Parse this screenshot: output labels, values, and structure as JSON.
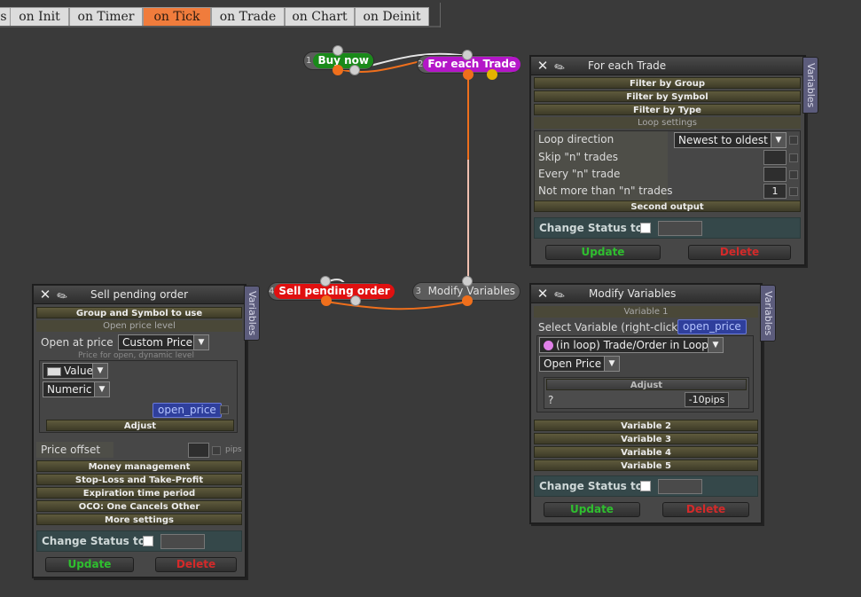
{
  "tabs": [
    {
      "label": "s",
      "active": false
    },
    {
      "label": "on Init",
      "active": false
    },
    {
      "label": "on Timer",
      "active": false
    },
    {
      "label": "on Tick",
      "active": true
    },
    {
      "label": "on Trade",
      "active": false
    },
    {
      "label": "on Chart",
      "active": false
    },
    {
      "label": "on Deinit",
      "active": false
    }
  ],
  "nodes": {
    "buy_now": {
      "num": "1",
      "label": "Buy now",
      "color": "#1a8a1a"
    },
    "for_each_trade": {
      "num": "2",
      "label": "For each Trade",
      "color": "#b416c8"
    },
    "modify_variables": {
      "num": "3",
      "label": "Modify Variables",
      "color": "#5c5c5c"
    },
    "sell_pending_order": {
      "num": "4",
      "label": "Sell pending order",
      "color": "#e01010"
    }
  },
  "wire_colors": {
    "main": "#ef6f1c",
    "light": "#e6e6e6",
    "vertical": "#f08050"
  },
  "panel_for_each": {
    "title": "For each Trade",
    "variables_tab": "Variables",
    "sections": [
      "Filter by Group",
      "Filter by Symbol",
      "Filter by Type"
    ],
    "loop_settings": "Loop settings",
    "rows": {
      "loop_direction": {
        "label": "Loop direction",
        "value": "Newest to oldest"
      },
      "skip_n": {
        "label": "Skip \"n\" trades",
        "value": ""
      },
      "every_n": {
        "label": "Every \"n\" trade",
        "value": ""
      },
      "not_more_than": {
        "label": "Not more than \"n\" trades",
        "value": "1"
      }
    },
    "second_output": "Second output",
    "change_status": "Change Status to",
    "update": "Update",
    "delete": "Delete"
  },
  "panel_sell": {
    "title": "Sell pending order",
    "variables_tab": "Variables",
    "group_symbol": "Group and Symbol to use",
    "open_price_level": "Open price level",
    "open_at_price_label": "Open at price",
    "open_at_price_value": "Custom Price",
    "price_hint": "Price for open, dynamic level",
    "value_type": "Value",
    "numeric": "Numeric",
    "variable": "open_price",
    "adjust": "Adjust",
    "price_offset": "Price offset",
    "pips": "pips",
    "sections": [
      "Money management",
      "Stop-Loss and Take-Profit",
      "Expiration time period",
      "OCO: One Cancels Other",
      "More settings"
    ],
    "change_status": "Change Status to",
    "update": "Update",
    "delete": "Delete"
  },
  "panel_modify": {
    "title": "Modify Variables",
    "variables_tab": "Variables",
    "variable1": "Variable 1",
    "select_label": "Select Variable (right-click)",
    "select_value": "open_price",
    "source": "(in loop) Trade/Order in Loop",
    "field": "Open Price",
    "adjust": "Adjust",
    "adjust_q": "?",
    "adjust_value": "-10pips",
    "sections": [
      "Variable 2",
      "Variable 3",
      "Variable 4",
      "Variable 5"
    ],
    "change_status": "Change Status to",
    "update": "Update",
    "delete": "Delete"
  }
}
